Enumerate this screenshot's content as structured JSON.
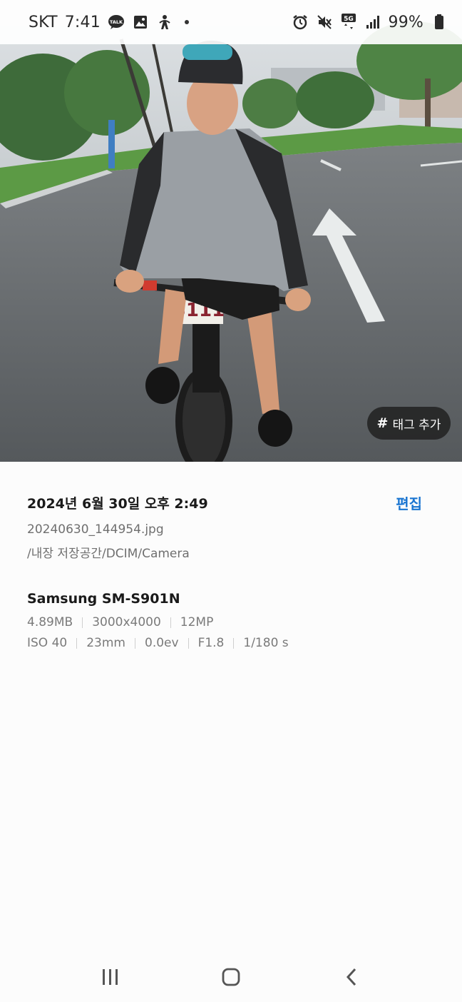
{
  "status_bar": {
    "carrier": "SKT",
    "time": "7:41",
    "left_icons": [
      "talk-icon",
      "gallery-icon",
      "accessibility-icon"
    ],
    "right_icons": [
      "alarm-icon",
      "mute-icon",
      "5g-icon",
      "signal-icon",
      "battery-icon"
    ],
    "network": "5G",
    "battery": "99%"
  },
  "photo": {
    "bib_number": "3111"
  },
  "tag_button": {
    "label": "태그 추가"
  },
  "details": {
    "date": "2024년 6월 30일 오후 2:49",
    "edit_label": "편집",
    "filename": "20240630_144954.jpg",
    "path": "/내장 저장공간/DCIM/Camera",
    "device": "Samsung SM-S901N",
    "specs_row1": [
      "4.89MB",
      "3000x4000",
      "12MP"
    ],
    "specs_row2": [
      "ISO 40",
      "23mm",
      "0.0ev",
      "F1.8",
      "1/180 s"
    ]
  },
  "navbar": {
    "buttons": [
      "recent-apps",
      "home",
      "back"
    ]
  },
  "colors": {
    "accent": "#1a75d1",
    "background": "#fcfcfc",
    "tag_bg": "#1e1e1e"
  }
}
